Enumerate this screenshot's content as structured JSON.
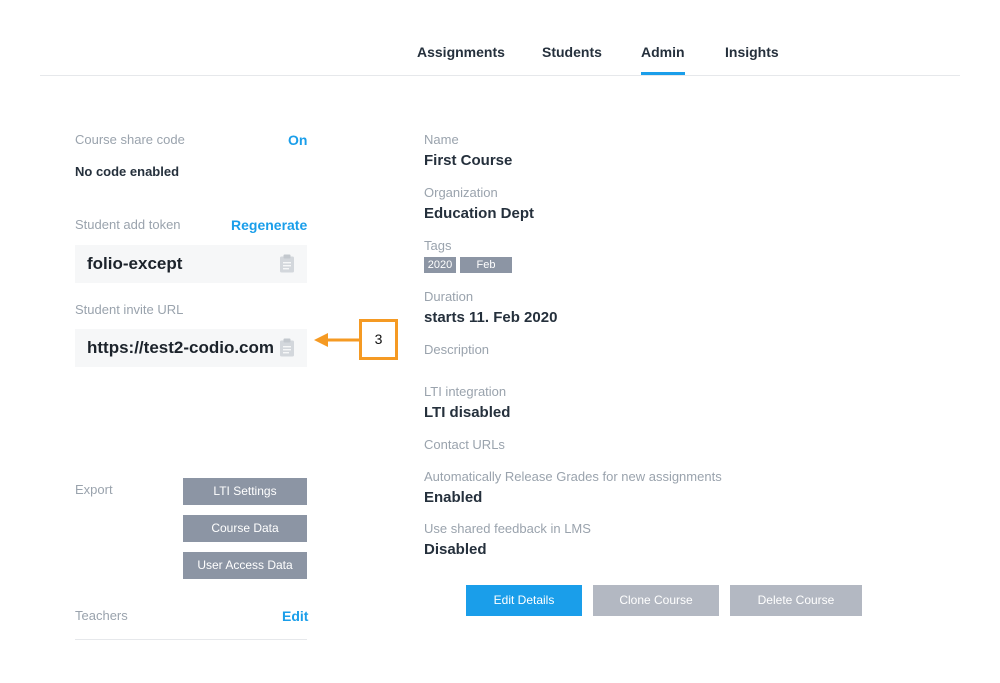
{
  "tabs": [
    {
      "label": "Assignments"
    },
    {
      "label": "Students"
    },
    {
      "label": "Admin"
    },
    {
      "label": "Insights"
    }
  ],
  "share_code": {
    "label": "Course share code",
    "toggle": "On",
    "status": "No code enabled"
  },
  "add_token": {
    "label": "Student add token",
    "action": "Regenerate",
    "value": "folio-except"
  },
  "invite_url": {
    "label": "Student invite URL",
    "value": "https://test2-codio.com/"
  },
  "export": {
    "label": "Export",
    "buttons": [
      "LTI Settings",
      "Course Data",
      "User Access Data"
    ]
  },
  "teachers": {
    "label": "Teachers",
    "action": "Edit"
  },
  "details": {
    "name_label": "Name",
    "name": "First Course",
    "org_label": "Organization",
    "org": "Education Dept",
    "tags_label": "Tags",
    "tags": [
      "2020",
      "Feb"
    ],
    "duration_label": "Duration",
    "duration": "starts 11. Feb 2020",
    "description_label": "Description",
    "lti_label": "LTI integration",
    "lti": "LTI disabled",
    "contact_label": "Contact URLs",
    "release_label": "Automatically Release Grades for new assignments",
    "release": "Enabled",
    "feedback_label": "Use shared feedback in LMS",
    "feedback": "Disabled"
  },
  "actions": {
    "edit": "Edit Details",
    "clone": "Clone Course",
    "delete": "Delete Course"
  },
  "annotation": {
    "number": "3"
  },
  "colors": {
    "accent": "#1a9eea",
    "gray_button": "#8c95a4",
    "annotation": "#f59a23",
    "disabled_button": "#b3b8c2"
  }
}
